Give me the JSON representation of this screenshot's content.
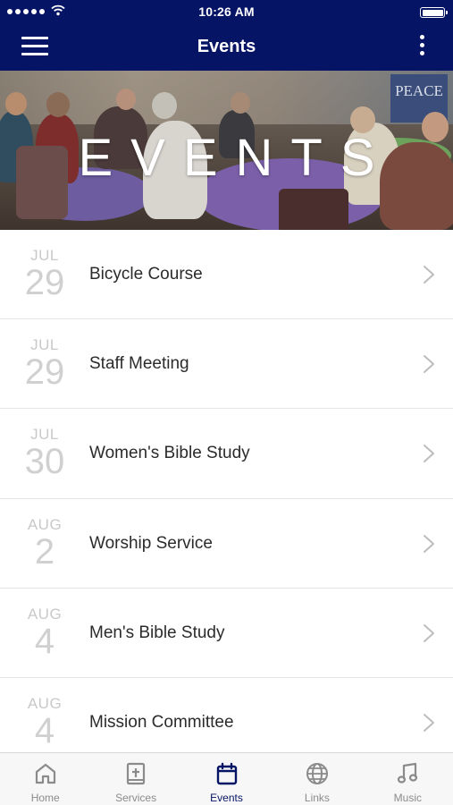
{
  "status_bar": {
    "time": "10:26 AM"
  },
  "nav_bar": {
    "title": "Events"
  },
  "hero": {
    "title": "EVENTS",
    "banner_text": "PEACE"
  },
  "events": [
    {
      "month": "JUL",
      "day": "29",
      "title": "Bicycle Course"
    },
    {
      "month": "JUL",
      "day": "29",
      "title": "Staff Meeting"
    },
    {
      "month": "JUL",
      "day": "30",
      "title": "Women's Bible Study"
    },
    {
      "month": "AUG",
      "day": "2",
      "title": "Worship Service"
    },
    {
      "month": "AUG",
      "day": "4",
      "title": "Men's Bible Study"
    },
    {
      "month": "AUG",
      "day": "4",
      "title": "Mission Committee"
    }
  ],
  "tabs": [
    {
      "label": "Home",
      "icon": "home-icon",
      "active": false
    },
    {
      "label": "Services",
      "icon": "services-icon",
      "active": false
    },
    {
      "label": "Events",
      "icon": "calendar-icon",
      "active": true
    },
    {
      "label": "Links",
      "icon": "globe-icon",
      "active": false
    },
    {
      "label": "Music",
      "icon": "music-note-icon",
      "active": false
    }
  ],
  "colors": {
    "brand_navy": "#061465",
    "tab_inactive": "#8b8b8b",
    "date_gray": "#c9c9c9"
  }
}
